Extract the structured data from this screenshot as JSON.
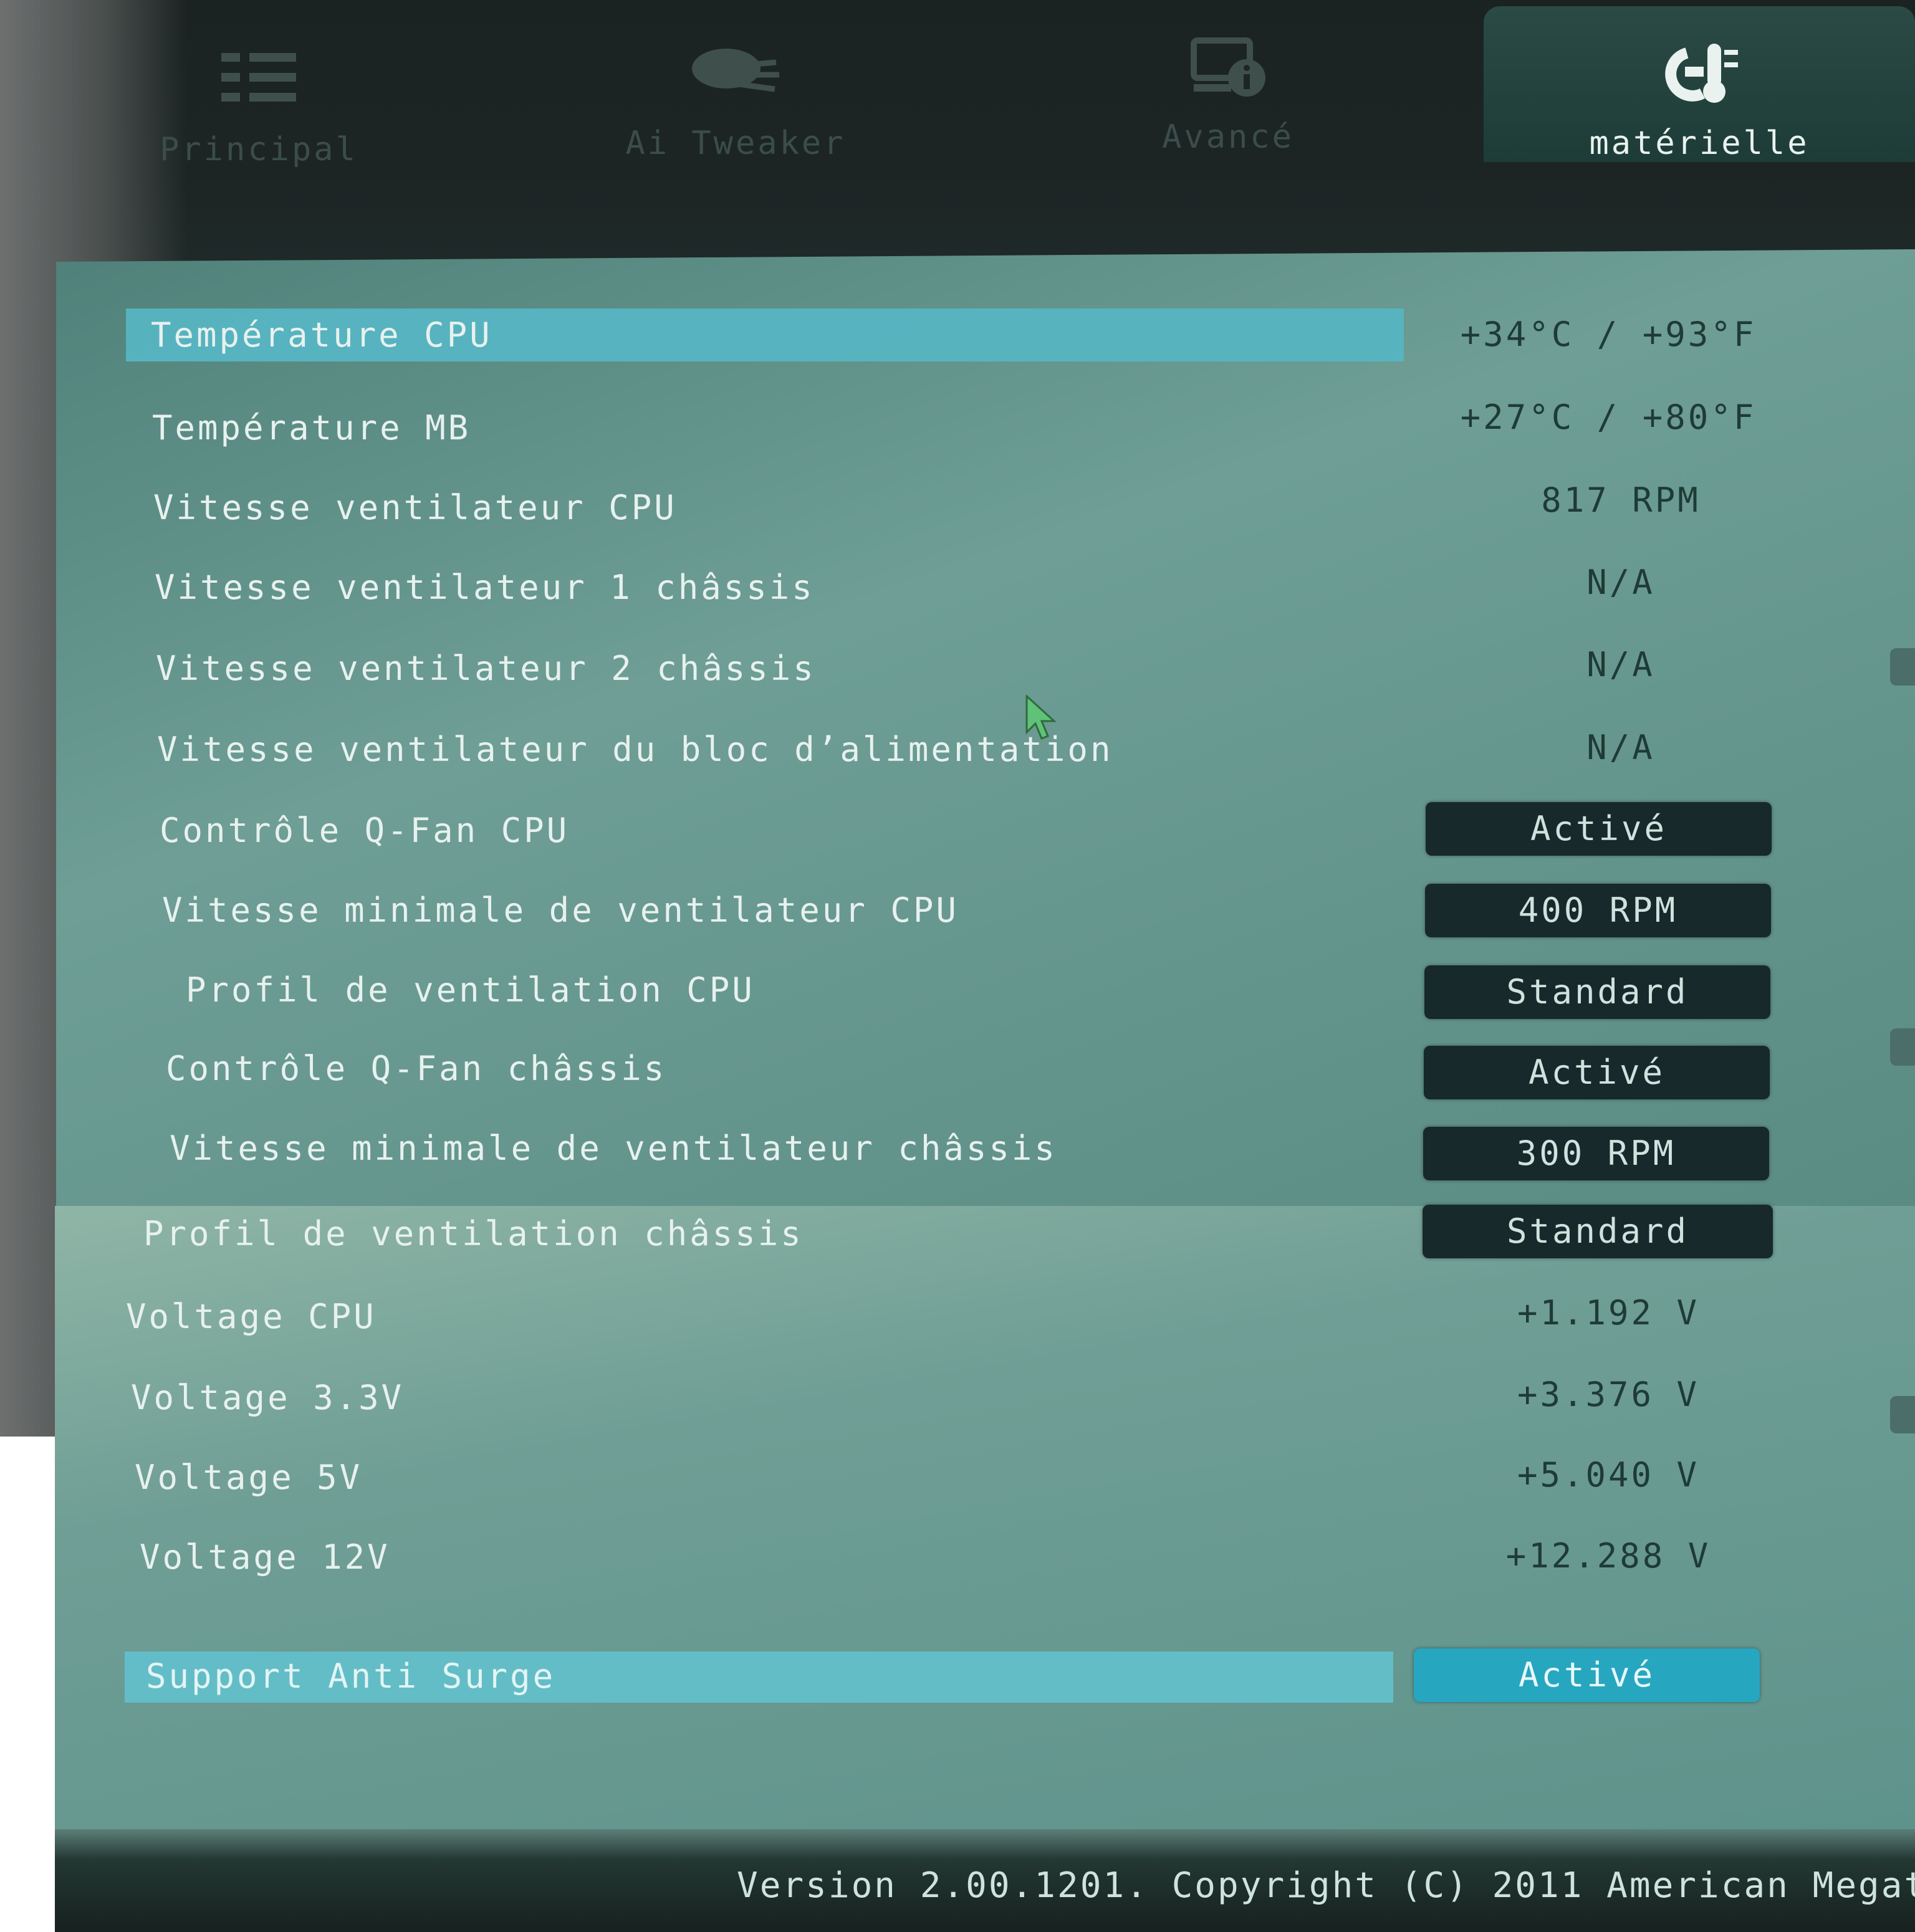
{
  "tabs": [
    {
      "label": "Principal",
      "icon": "list-icon"
    },
    {
      "label": "Ai Tweaker",
      "icon": "tweaker-icon"
    },
    {
      "label": "Avancé",
      "icon": "advanced-info-icon"
    },
    {
      "label": "matérielle",
      "icon": "hardware-monitor-icon",
      "active": true
    }
  ],
  "rows": [
    {
      "name": "Température CPU",
      "value": "+34°C / +93°F"
    },
    {
      "name": "Température MB",
      "value": "+27°C / +80°F"
    },
    {
      "name": "Vitesse ventilateur CPU",
      "value": "817 RPM"
    },
    {
      "name": "Vitesse ventilateur 1 châssis",
      "value": "N/A"
    },
    {
      "name": "Vitesse ventilateur 2 châssis",
      "value": "N/A"
    },
    {
      "name": "Vitesse ventilateur du bloc d’alimentation",
      "value": "N/A"
    },
    {
      "name": "Contrôle Q-Fan CPU",
      "value": "Activé"
    },
    {
      "name": "Vitesse minimale de ventilateur CPU",
      "value": "400 RPM"
    },
    {
      "name": "Profil de ventilation CPU",
      "value": "Standard"
    },
    {
      "name": "Contrôle Q-Fan châssis",
      "value": "Activé"
    },
    {
      "name": "Vitesse minimale de ventilateur châssis",
      "value": "300 RPM"
    },
    {
      "name": "Profil de ventilation châssis",
      "value": "Standard"
    },
    {
      "name": "Voltage CPU",
      "value": "+1.192 V"
    },
    {
      "name": "Voltage 3.3V",
      "value": "+3.376 V"
    },
    {
      "name": "Voltage 5V",
      "value": "+5.040 V"
    },
    {
      "name": "Voltage 12V",
      "value": "+12.288 V"
    },
    {
      "name": "Support Anti Surge",
      "value": "Activé"
    }
  ],
  "footer": {
    "text": "Version 2.00.1201. Copyright (C) 2011 American Megat"
  },
  "colors": {
    "highlight": "#56b5c2",
    "button": "#17292a",
    "selected_button": "#27a6c0"
  }
}
